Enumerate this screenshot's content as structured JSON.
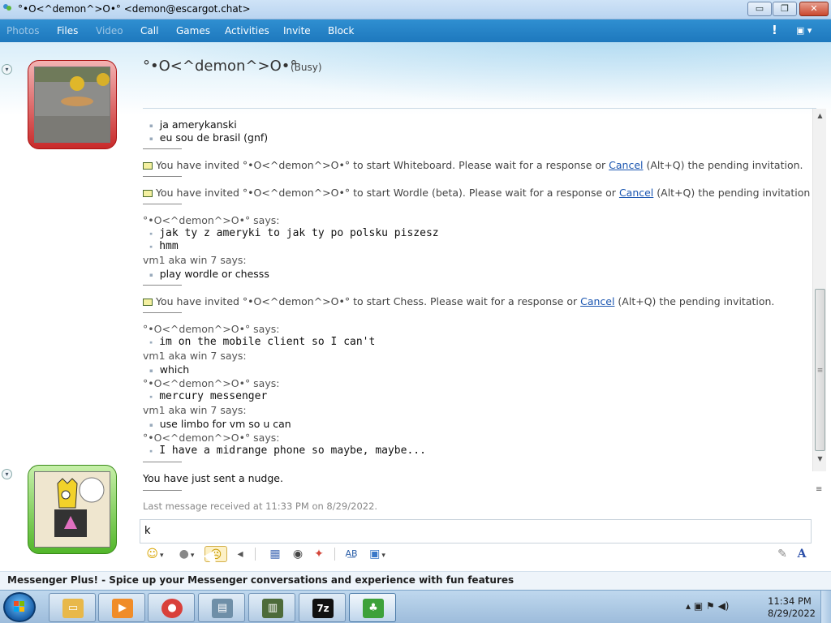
{
  "window": {
    "title": "°•O<^demon^>O•° <demon@escargot.chat>",
    "minimize_label": "▭",
    "maximize_label": "❐",
    "close_label": "✕"
  },
  "menu": {
    "items": [
      {
        "label": "Photos",
        "enabled": false
      },
      {
        "label": "Files",
        "enabled": true
      },
      {
        "label": "Video",
        "enabled": false
      },
      {
        "label": "Call",
        "enabled": true
      },
      {
        "label": "Games",
        "enabled": true
      },
      {
        "label": "Activities",
        "enabled": true
      },
      {
        "label": "Invite",
        "enabled": true
      },
      {
        "label": "Block",
        "enabled": true
      }
    ],
    "alert_label": "!",
    "menu_icon": "show-menu-icon"
  },
  "contact": {
    "name": "°•O<^demon^>O•°",
    "status": "(Busy)",
    "status_color": "#c82a2a"
  },
  "conversation": {
    "line_0": "ja amerykanski",
    "line_1": "eu sou de brasil (gnf)",
    "invite_1_before": "You have invited °•O<^demon^>O•° to start Whiteboard. Please wait for a response or ",
    "invite_1_link": "Cancel",
    "invite_1_after": " (Alt+Q) the pending invitation.",
    "invite_2_before": "You have invited °•O<^demon^>O•° to start Wordle (beta). Please wait for a response or ",
    "invite_2_link": "Cancel",
    "invite_2_after": " (Alt+Q) the pending invitation.",
    "says_demon": "°•O<^demon^>O•° says:",
    "says_me": "vm1 aka win 7 says:",
    "msg_1": "jak ty z ameryki to jak ty po polsku piszesz",
    "msg_2": "hmm",
    "msg_3": "play wordle or chesss",
    "invite_3_before": "You have invited °•O<^demon^>O•° to start Chess. Please wait for a response or ",
    "invite_3_link": "Cancel",
    "invite_3_after": " (Alt+Q) the pending invitation.",
    "msg_4": "im on the mobile client so I can't",
    "msg_5": "which",
    "msg_6": "mercury messenger",
    "msg_7": "use limbo for vm so u can",
    "msg_8": "I have a midrange phone so maybe, maybe..."
  },
  "nudge": "You have just sent a nudge.",
  "last_received": "Last message received at 11:33 PM on 8/29/2022.",
  "input": {
    "value": "k"
  },
  "toolbar": {
    "emoticons": "☺",
    "winks": "●",
    "nudge": "☹",
    "voice_clip": "◂",
    "background": "▦",
    "sound": "◉",
    "plus": "✦",
    "font": "A͟B",
    "send_file": "▣",
    "handwriting": "✎",
    "text_style": "A"
  },
  "plus_bar": "Messenger Plus! - Spice up your Messenger conversations and experience with fun features",
  "taskbar": {
    "apps": [
      {
        "name": "explorer",
        "glyph": "▭",
        "color": "#e8b84a"
      },
      {
        "name": "media-player",
        "glyph": "▶",
        "color": "#f08c28"
      },
      {
        "name": "chrome",
        "glyph": "●",
        "color": "#d9403a"
      },
      {
        "name": "window-app",
        "glyph": "▤",
        "color": "#6f8fa8"
      },
      {
        "name": "terminal",
        "glyph": "▥",
        "color": "#4d6b3a"
      },
      {
        "name": "7zip",
        "glyph": "7z",
        "color": "#111111"
      },
      {
        "name": "messenger",
        "glyph": "♣",
        "color": "#3da13a"
      }
    ],
    "tray": "▴  ▣  ⚑  ◀)",
    "time": "11:34 PM",
    "date": "8/29/2022"
  }
}
